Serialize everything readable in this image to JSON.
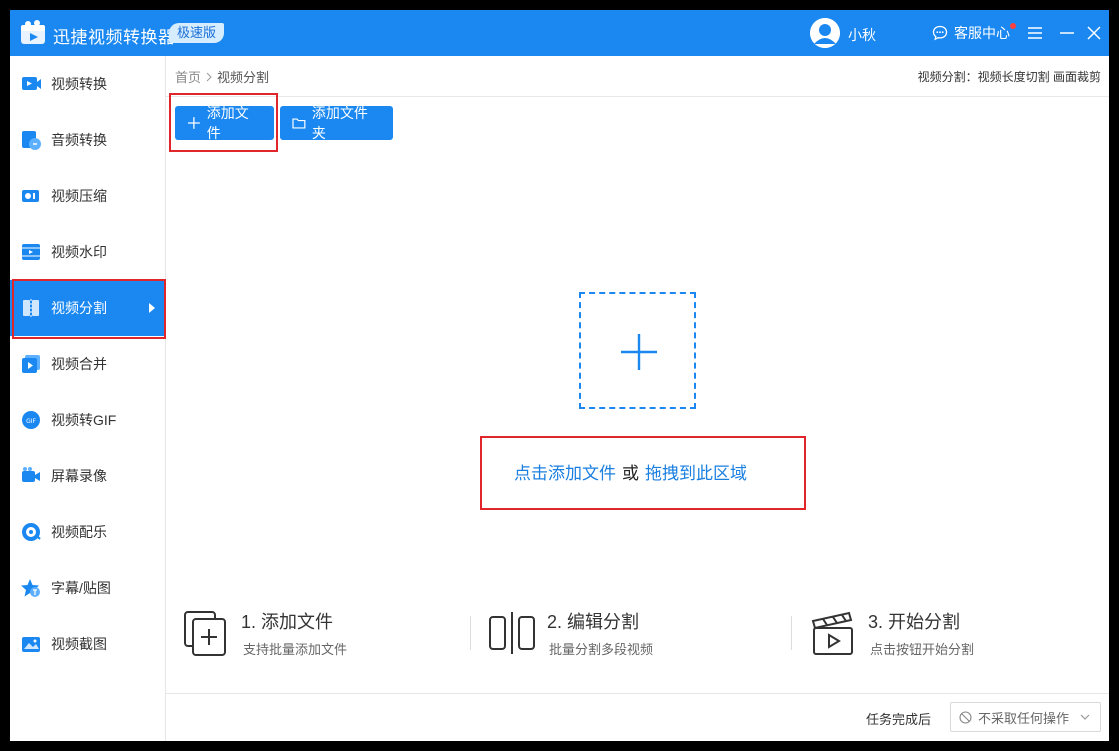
{
  "app": {
    "title": "迅捷视频转换器",
    "edition": "极速版",
    "username": "小秋",
    "service_label": "客服中心"
  },
  "sidebar": {
    "items": [
      {
        "label": "视频转换",
        "icon": "video-convert-icon"
      },
      {
        "label": "音频转换",
        "icon": "audio-convert-icon"
      },
      {
        "label": "视频压缩",
        "icon": "video-compress-icon"
      },
      {
        "label": "视频水印",
        "icon": "video-watermark-icon"
      },
      {
        "label": "视频分割",
        "icon": "video-split-icon",
        "active": true
      },
      {
        "label": "视频合并",
        "icon": "video-merge-icon"
      },
      {
        "label": "视频转GIF",
        "icon": "video-gif-icon"
      },
      {
        "label": "屏幕录像",
        "icon": "screen-record-icon"
      },
      {
        "label": "视频配乐",
        "icon": "video-music-icon"
      },
      {
        "label": "字幕/贴图",
        "icon": "subtitle-sticker-icon"
      },
      {
        "label": "视频截图",
        "icon": "video-screenshot-icon"
      }
    ]
  },
  "main": {
    "breadcrumb": {
      "home": "首页",
      "current": "视频分割"
    },
    "top_hint": "视频分割：视频长度切割 画面裁剪",
    "add_file_label": "添加文件",
    "add_folder_label": "添加文件夹",
    "drop_hint": {
      "click": "点击添加文件",
      "or": "或",
      "drag": "拖拽到此区域"
    },
    "steps": [
      {
        "title": "1. 添加文件",
        "desc": "支持批量添加文件",
        "icon": "add-files-icon"
      },
      {
        "title": "2. 编辑分割",
        "desc": "批量分割多段视频",
        "icon": "split-edit-icon"
      },
      {
        "title": "3. 开始分割",
        "desc": "点击按钮开始分割",
        "icon": "clapperboard-icon"
      }
    ]
  },
  "footer": {
    "label": "任务完成后",
    "select_value": "不采取任何操作"
  },
  "colors": {
    "brand": "#1a88f0",
    "highlight_box": "#e0262a",
    "link": "#1a7fe0"
  }
}
